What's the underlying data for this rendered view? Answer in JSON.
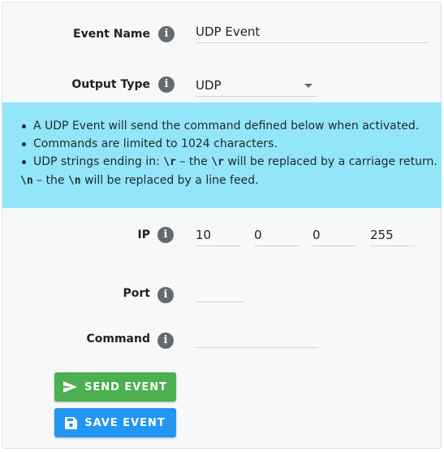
{
  "form": {
    "event_name": {
      "label": "Event Name",
      "value": "UDP Event"
    },
    "output_type": {
      "label": "Output Type",
      "value": "UDP"
    },
    "info": {
      "bullet1": "A UDP Event will send the command defined below when activated.",
      "bullet2": "Commands are limited to 1024 characters.",
      "bullet3_a": "UDP strings ending in: ",
      "code_r": "\\r",
      "bullet3_b": " – the ",
      "code_r2": "\\r",
      "bullet3_c": " will be replaced by a carriage return.",
      "code_n": "\\n",
      "bullet3_d": " – the ",
      "code_n2": "\\n",
      "bullet3_e": " will be replaced by a line feed."
    },
    "ip": {
      "label": "IP",
      "octets": [
        "10",
        "0",
        "0",
        "255"
      ]
    },
    "port": {
      "label": "Port",
      "value": ""
    },
    "command": {
      "label": "Command",
      "value": ""
    }
  },
  "buttons": {
    "send_label": "SEND EVENT",
    "save_label": "SAVE EVENT",
    "send_color": "#4caf50",
    "save_color": "#2196f3"
  },
  "icons": {
    "info": "info-icon",
    "send": "send-icon",
    "save": "save-icon",
    "dropdown": "chevron-down-icon"
  }
}
